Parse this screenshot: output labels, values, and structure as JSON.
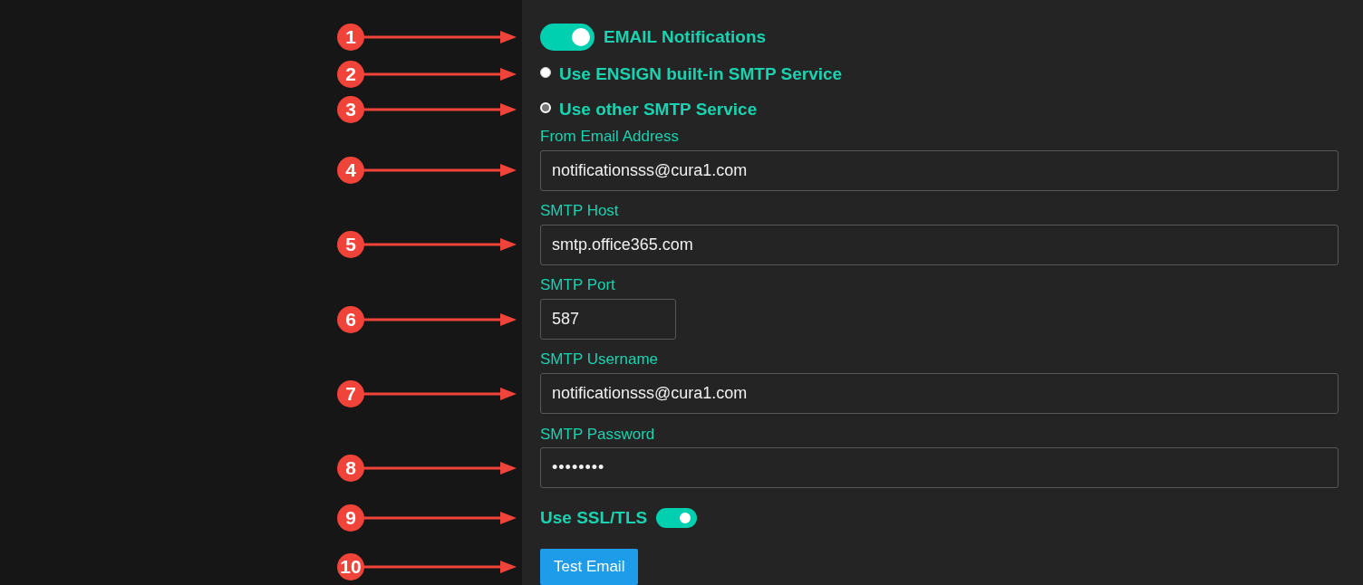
{
  "items": [
    {
      "kind": "toggle",
      "label": "EMAIL Notifications",
      "on": true,
      "callout": "1"
    },
    {
      "kind": "radio",
      "label": "Use ENSIGN built-in SMTP Service",
      "selected": false,
      "callout": "2"
    },
    {
      "kind": "radio",
      "label": "Use other SMTP Service",
      "selected": true,
      "callout": "3"
    },
    {
      "kind": "field",
      "label": "From Email Address",
      "value": "notificationsss@cura1.com",
      "callout": "4"
    },
    {
      "kind": "field",
      "label": "SMTP Host",
      "value": "smtp.office365.com",
      "callout": "5"
    },
    {
      "kind": "short-field",
      "label": "SMTP Port",
      "value": "587",
      "callout": "6"
    },
    {
      "kind": "field",
      "label": "SMTP Username",
      "value": "notificationsss@cura1.com",
      "callout": "7"
    },
    {
      "kind": "password",
      "label": "SMTP Password",
      "value": "••••••••",
      "callout": "8"
    },
    {
      "kind": "inline-switch",
      "label": "Use SSL/TLS",
      "on": true,
      "callout": "9"
    },
    {
      "kind": "button",
      "label": "Test Email",
      "callout": "10"
    }
  ]
}
